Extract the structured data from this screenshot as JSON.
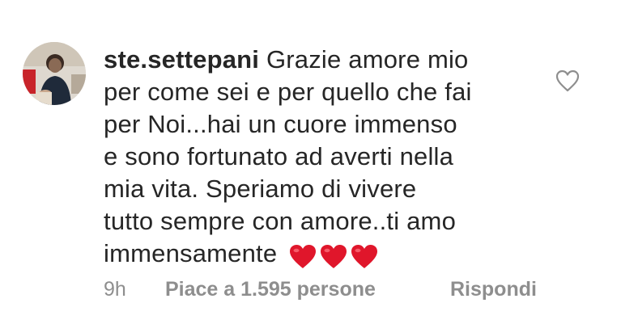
{
  "comment": {
    "username": "ste.settepani",
    "text_lines": [
      "Grazie amore mio",
      "per come sei e per quello che fai",
      "per Noi...hai un cuore immenso",
      "e sono fortunato ad averti nella",
      "mia vita. Speriamo di vivere",
      "tutto sempre con amore..ti amo",
      "immensamente"
    ],
    "emoji": [
      "❤️",
      "❤️",
      "❤️"
    ],
    "emoji_icon": "red-heart",
    "like_icon": "heart-outline-icon"
  },
  "meta": {
    "time": "9h",
    "likes": "Piace a 1.595 persone",
    "reply": "Rispondi"
  },
  "colors": {
    "text": "#262626",
    "secondary": "#8e8e8e",
    "heart": "#e0162b"
  }
}
